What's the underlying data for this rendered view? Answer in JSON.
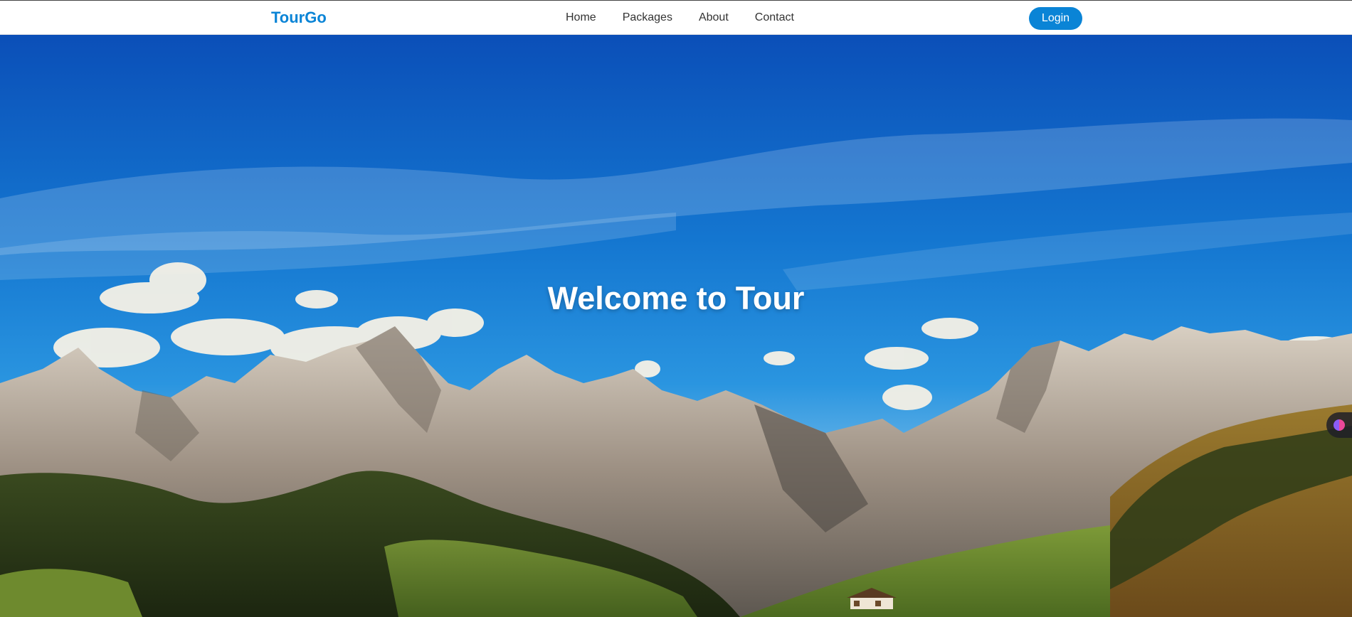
{
  "navbar": {
    "brand": "TourGo",
    "links": [
      "Home",
      "Packages",
      "About",
      "Contact"
    ],
    "login_label": "Login"
  },
  "hero": {
    "title": "Welcome to Tour",
    "background": "mountain-landscape-image"
  },
  "side_widget": {
    "icon": "assistant-icon"
  },
  "colors": {
    "accent": "#0a84d6",
    "nav_text": "#333333",
    "sky_top": "#0b4fb8",
    "sky_mid": "#1f8ee0"
  }
}
